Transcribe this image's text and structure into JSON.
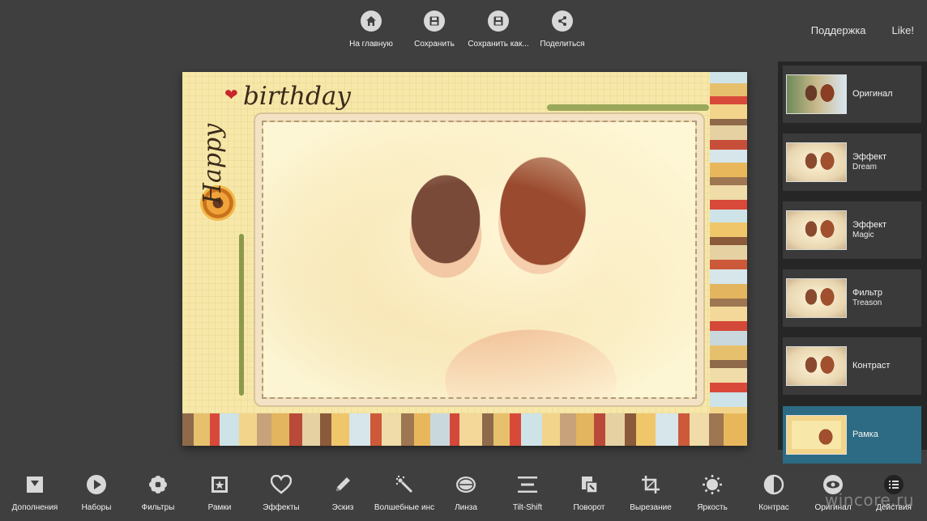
{
  "top_toolbar": {
    "items": [
      {
        "label": "На главную",
        "icon": "home-icon"
      },
      {
        "label": "Сохранить",
        "icon": "save-icon"
      },
      {
        "label": "Сохранить как...",
        "icon": "save-as-icon"
      },
      {
        "label": "Поделиться",
        "icon": "share-icon"
      }
    ]
  },
  "top_right": {
    "support": "Поддержка",
    "like": "Like!"
  },
  "canvas": {
    "happy": "Happy",
    "birthday": "birthday"
  },
  "effects": [
    {
      "name": "Оригинал",
      "sub": "",
      "selected": false
    },
    {
      "name": "Эффект",
      "sub": "Dream",
      "selected": false
    },
    {
      "name": "Эффект",
      "sub": "Magic",
      "selected": false
    },
    {
      "name": "Фильтр",
      "sub": "Treason",
      "selected": false
    },
    {
      "name": "Контраст",
      "sub": "",
      "selected": false
    },
    {
      "name": "Рамка",
      "sub": "",
      "selected": true
    }
  ],
  "bottom_toolbar": {
    "items": [
      {
        "label": "Дополнения",
        "icon": "download-icon"
      },
      {
        "label": "Наборы",
        "icon": "play-icon"
      },
      {
        "label": "Фильтры",
        "icon": "flower-icon"
      },
      {
        "label": "Рамки",
        "icon": "frame-icon"
      },
      {
        "label": "Эффекты",
        "icon": "heart-icon"
      },
      {
        "label": "Эскиз",
        "icon": "pencil-icon"
      },
      {
        "label": "Волшебные инс",
        "icon": "magic-wand-icon"
      },
      {
        "label": "Линза",
        "icon": "lens-icon"
      },
      {
        "label": "Tilt-Shift",
        "icon": "tilt-shift-icon"
      },
      {
        "label": "Поворот",
        "icon": "rotate-icon"
      },
      {
        "label": "Вырезание",
        "icon": "crop-icon"
      },
      {
        "label": "Яркость",
        "icon": "brightness-icon"
      },
      {
        "label": "Контрас",
        "icon": "contrast-icon"
      },
      {
        "label": "Оригинал",
        "icon": "eye-icon"
      },
      {
        "label": "Действия",
        "icon": "list-icon"
      }
    ]
  },
  "watermark": "wincore.ru",
  "colors": {
    "background": "#3f3f3f",
    "panel": "#262626",
    "selected": "#2c6b83",
    "icon": "#d8d8d8"
  }
}
